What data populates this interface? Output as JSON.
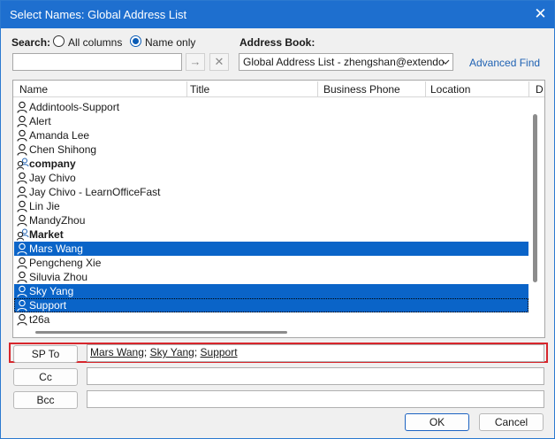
{
  "window": {
    "title": "Select Names: Global Address List",
    "close_glyph": "✕"
  },
  "search": {
    "label": "Search:",
    "options": [
      "All columns",
      "Name only"
    ],
    "selected": "Name only",
    "value": "",
    "go_glyph": "→",
    "clear_glyph": "✕"
  },
  "address_book": {
    "label": "Address Book:",
    "value": "Global Address List - zhengshan@extendo",
    "advanced_find": "Advanced Find"
  },
  "columns": [
    "Name",
    "Title",
    "Business Phone",
    "Location",
    "D"
  ],
  "contacts": [
    {
      "name": "Addintools-Support",
      "type": "user",
      "selected": false,
      "bold": false
    },
    {
      "name": "Alert",
      "type": "user",
      "selected": false,
      "bold": false
    },
    {
      "name": "Amanda Lee",
      "type": "user",
      "selected": false,
      "bold": false
    },
    {
      "name": "Chen Shihong",
      "type": "user",
      "selected": false,
      "bold": false
    },
    {
      "name": "company",
      "type": "group",
      "selected": false,
      "bold": true
    },
    {
      "name": "Jay Chivo",
      "type": "user",
      "selected": false,
      "bold": false
    },
    {
      "name": "Jay Chivo - LearnOfficeFast",
      "type": "user",
      "selected": false,
      "bold": false
    },
    {
      "name": "Lin Jie",
      "type": "user",
      "selected": false,
      "bold": false
    },
    {
      "name": "MandyZhou",
      "type": "user",
      "selected": false,
      "bold": false
    },
    {
      "name": "Market",
      "type": "group",
      "selected": false,
      "bold": true
    },
    {
      "name": "Mars Wang",
      "type": "user",
      "selected": true,
      "bold": false
    },
    {
      "name": "Pengcheng Xie",
      "type": "user",
      "selected": false,
      "bold": false
    },
    {
      "name": "Siluvia Zhou",
      "type": "user",
      "selected": false,
      "bold": false
    },
    {
      "name": "Sky Yang",
      "type": "user",
      "selected": true,
      "bold": false
    },
    {
      "name": "Support",
      "type": "user",
      "selected": true,
      "bold": false
    },
    {
      "name": "t26a",
      "type": "user",
      "selected": false,
      "bold": false
    }
  ],
  "recipients": {
    "to": {
      "button": "SP To",
      "names": [
        "Mars Wang",
        "Sky Yang",
        "Support"
      ],
      "separator": "; "
    },
    "cc": {
      "button": "Cc",
      "value": ""
    },
    "bcc": {
      "button": "Bcc",
      "value": ""
    }
  },
  "footer": {
    "ok": "OK",
    "cancel": "Cancel"
  },
  "colors": {
    "accent": "#1e6fcf",
    "selection": "#0a64c8",
    "highlight_border": "#d7262c",
    "link": "#1f62b3"
  }
}
